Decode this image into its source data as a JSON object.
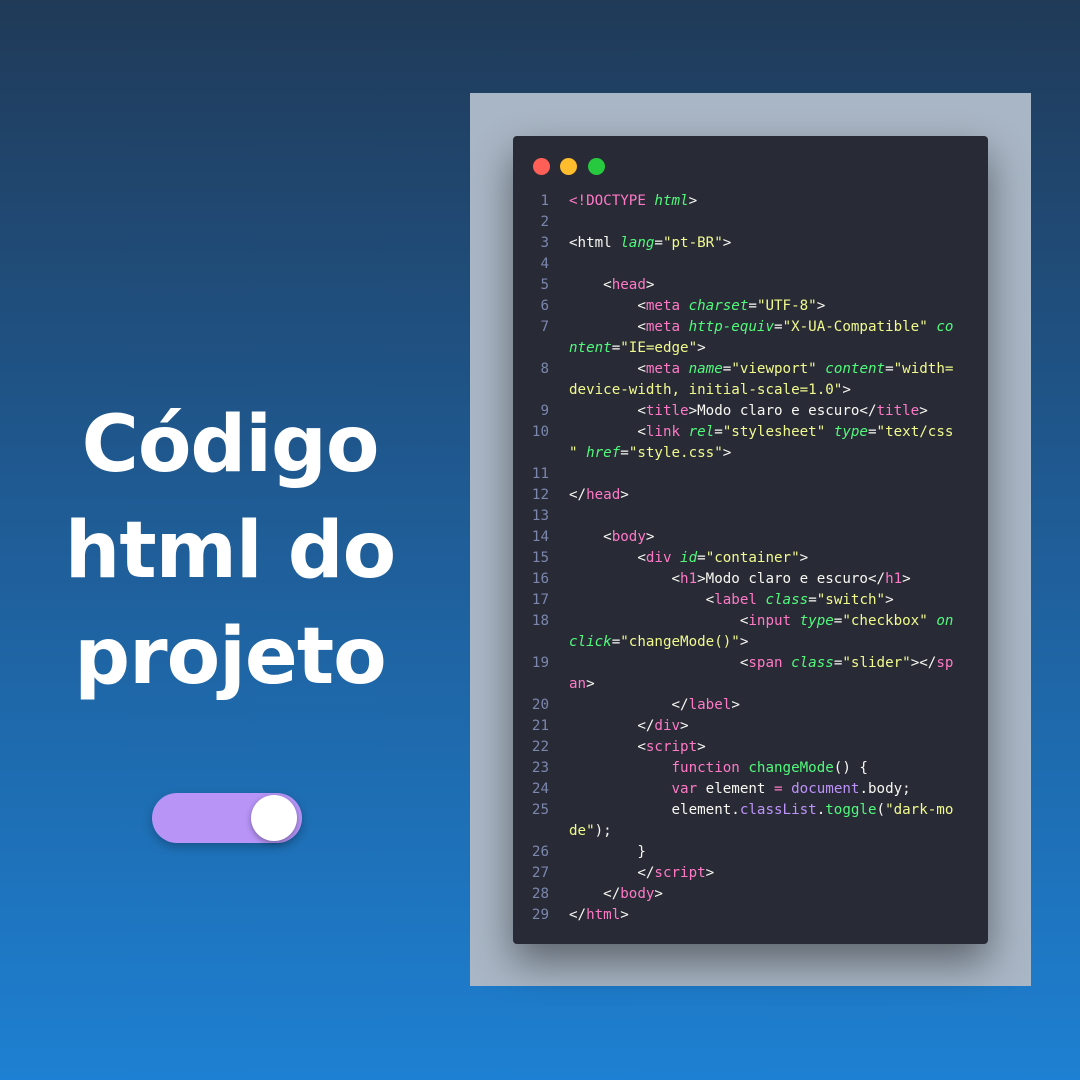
{
  "heading": {
    "line1": "Código",
    "line2": "html do",
    "line3": "projeto"
  },
  "toggle": {
    "state": "on",
    "track_color": "#b794f6",
    "knob_color": "#ffffff"
  },
  "editor": {
    "window_controls": [
      "close",
      "minimize",
      "maximize"
    ],
    "lines": [
      {
        "n": "1",
        "tokens": [
          {
            "t": "<!DOCTYPE ",
            "c": "tag"
          },
          {
            "t": "html",
            "c": "attr"
          },
          {
            "t": ">",
            "c": "text"
          }
        ]
      },
      {
        "n": "2",
        "tokens": []
      },
      {
        "n": "3",
        "tokens": [
          {
            "t": "<html ",
            "c": "text"
          },
          {
            "t": "lang",
            "c": "attr"
          },
          {
            "t": "=",
            "c": "text"
          },
          {
            "t": "\"pt-BR\"",
            "c": "str"
          },
          {
            "t": ">",
            "c": "text"
          }
        ]
      },
      {
        "n": "4",
        "tokens": []
      },
      {
        "n": "5",
        "tokens": [
          {
            "t": "    <",
            "c": "text"
          },
          {
            "t": "head",
            "c": "tag"
          },
          {
            "t": ">",
            "c": "text"
          }
        ]
      },
      {
        "n": "6",
        "tokens": [
          {
            "t": "        <",
            "c": "text"
          },
          {
            "t": "meta ",
            "c": "tag"
          },
          {
            "t": "charset",
            "c": "attr"
          },
          {
            "t": "=",
            "c": "text"
          },
          {
            "t": "\"UTF-8\"",
            "c": "str"
          },
          {
            "t": ">",
            "c": "text"
          }
        ]
      },
      {
        "n": "7",
        "tokens": [
          {
            "t": "        <",
            "c": "text"
          },
          {
            "t": "meta ",
            "c": "tag"
          },
          {
            "t": "http-equiv",
            "c": "attr"
          },
          {
            "t": "=",
            "c": "text"
          },
          {
            "t": "\"X-UA-Compatible\" ",
            "c": "str"
          },
          {
            "t": "co",
            "c": "attr"
          }
        ]
      },
      {
        "n": "",
        "tokens": [
          {
            "t": "ntent",
            "c": "attr"
          },
          {
            "t": "=",
            "c": "text"
          },
          {
            "t": "\"IE=edge\"",
            "c": "str"
          },
          {
            "t": ">",
            "c": "text"
          }
        ]
      },
      {
        "n": "8",
        "tokens": [
          {
            "t": "        <",
            "c": "text"
          },
          {
            "t": "meta ",
            "c": "tag"
          },
          {
            "t": "name",
            "c": "attr"
          },
          {
            "t": "=",
            "c": "text"
          },
          {
            "t": "\"viewport\" ",
            "c": "str"
          },
          {
            "t": "content",
            "c": "attr"
          },
          {
            "t": "=",
            "c": "text"
          },
          {
            "t": "\"width=",
            "c": "str"
          }
        ]
      },
      {
        "n": "",
        "tokens": [
          {
            "t": "device-width, initial-scale=1.0\"",
            "c": "str"
          },
          {
            "t": ">",
            "c": "text"
          }
        ]
      },
      {
        "n": "9",
        "tokens": [
          {
            "t": "        <",
            "c": "text"
          },
          {
            "t": "title",
            "c": "tag"
          },
          {
            "t": ">Modo claro e escuro</",
            "c": "text"
          },
          {
            "t": "title",
            "c": "tag"
          },
          {
            "t": ">",
            "c": "text"
          }
        ]
      },
      {
        "n": "10",
        "tokens": [
          {
            "t": "        <",
            "c": "text"
          },
          {
            "t": "link ",
            "c": "tag"
          },
          {
            "t": "rel",
            "c": "attr"
          },
          {
            "t": "=",
            "c": "text"
          },
          {
            "t": "\"stylesheet\" ",
            "c": "str"
          },
          {
            "t": "type",
            "c": "attr"
          },
          {
            "t": "=",
            "c": "text"
          },
          {
            "t": "\"text/css",
            "c": "str"
          }
        ]
      },
      {
        "n": "",
        "tokens": [
          {
            "t": "\" ",
            "c": "str"
          },
          {
            "t": "href",
            "c": "attr"
          },
          {
            "t": "=",
            "c": "text"
          },
          {
            "t": "\"style.css\"",
            "c": "str"
          },
          {
            "t": ">",
            "c": "text"
          }
        ]
      },
      {
        "n": "11",
        "tokens": []
      },
      {
        "n": "12",
        "tokens": [
          {
            "t": "</",
            "c": "text"
          },
          {
            "t": "head",
            "c": "tag"
          },
          {
            "t": ">",
            "c": "text"
          }
        ]
      },
      {
        "n": "13",
        "tokens": []
      },
      {
        "n": "14",
        "tokens": [
          {
            "t": "    <",
            "c": "text"
          },
          {
            "t": "body",
            "c": "tag"
          },
          {
            "t": ">",
            "c": "text"
          }
        ]
      },
      {
        "n": "15",
        "tokens": [
          {
            "t": "        <",
            "c": "text"
          },
          {
            "t": "div ",
            "c": "tag"
          },
          {
            "t": "id",
            "c": "attr"
          },
          {
            "t": "=",
            "c": "text"
          },
          {
            "t": "\"container\"",
            "c": "str"
          },
          {
            "t": ">",
            "c": "text"
          }
        ]
      },
      {
        "n": "16",
        "tokens": [
          {
            "t": "            <",
            "c": "text"
          },
          {
            "t": "h1",
            "c": "tag"
          },
          {
            "t": ">Modo claro e escuro</",
            "c": "text"
          },
          {
            "t": "h1",
            "c": "tag"
          },
          {
            "t": ">",
            "c": "text"
          }
        ]
      },
      {
        "n": "17",
        "tokens": [
          {
            "t": "                <",
            "c": "text"
          },
          {
            "t": "label ",
            "c": "tag"
          },
          {
            "t": "class",
            "c": "attr"
          },
          {
            "t": "=",
            "c": "text"
          },
          {
            "t": "\"switch\"",
            "c": "str"
          },
          {
            "t": ">",
            "c": "text"
          }
        ]
      },
      {
        "n": "18",
        "tokens": [
          {
            "t": "                    <",
            "c": "text"
          },
          {
            "t": "input ",
            "c": "tag"
          },
          {
            "t": "type",
            "c": "attr"
          },
          {
            "t": "=",
            "c": "text"
          },
          {
            "t": "\"checkbox\" ",
            "c": "str"
          },
          {
            "t": "on",
            "c": "attr"
          }
        ]
      },
      {
        "n": "",
        "tokens": [
          {
            "t": "click",
            "c": "attr"
          },
          {
            "t": "=",
            "c": "text"
          },
          {
            "t": "\"changeMode()\"",
            "c": "str"
          },
          {
            "t": ">",
            "c": "text"
          }
        ]
      },
      {
        "n": "19",
        "tokens": [
          {
            "t": "                    <",
            "c": "text"
          },
          {
            "t": "span ",
            "c": "tag"
          },
          {
            "t": "class",
            "c": "attr"
          },
          {
            "t": "=",
            "c": "text"
          },
          {
            "t": "\"slider\"",
            "c": "str"
          },
          {
            "t": "></",
            "c": "text"
          },
          {
            "t": "sp",
            "c": "tag"
          }
        ]
      },
      {
        "n": "",
        "tokens": [
          {
            "t": "an",
            "c": "tag"
          },
          {
            "t": ">",
            "c": "text"
          }
        ]
      },
      {
        "n": "20",
        "tokens": [
          {
            "t": "            </",
            "c": "text"
          },
          {
            "t": "label",
            "c": "tag"
          },
          {
            "t": ">",
            "c": "text"
          }
        ]
      },
      {
        "n": "21",
        "tokens": [
          {
            "t": "        </",
            "c": "text"
          },
          {
            "t": "div",
            "c": "tag"
          },
          {
            "t": ">",
            "c": "text"
          }
        ]
      },
      {
        "n": "22",
        "tokens": [
          {
            "t": "        <",
            "c": "text"
          },
          {
            "t": "script",
            "c": "tag"
          },
          {
            "t": ">",
            "c": "text"
          }
        ]
      },
      {
        "n": "23",
        "tokens": [
          {
            "t": "            ",
            "c": "text"
          },
          {
            "t": "function ",
            "c": "kw"
          },
          {
            "t": "changeMode",
            "c": "fn"
          },
          {
            "t": "() {",
            "c": "text"
          }
        ]
      },
      {
        "n": "24",
        "tokens": [
          {
            "t": "            ",
            "c": "text"
          },
          {
            "t": "var ",
            "c": "kw"
          },
          {
            "t": "element ",
            "c": "text"
          },
          {
            "t": "= ",
            "c": "kw"
          },
          {
            "t": "document",
            "c": "obj"
          },
          {
            "t": ".body;",
            "c": "text"
          }
        ]
      },
      {
        "n": "25",
        "tokens": [
          {
            "t": "            element.",
            "c": "text"
          },
          {
            "t": "classList",
            "c": "obj"
          },
          {
            "t": ".",
            "c": "text"
          },
          {
            "t": "toggle",
            "c": "fn"
          },
          {
            "t": "(",
            "c": "text"
          },
          {
            "t": "\"dark-mo",
            "c": "str"
          }
        ]
      },
      {
        "n": "",
        "tokens": [
          {
            "t": "de\"",
            "c": "str"
          },
          {
            "t": ");",
            "c": "text"
          }
        ]
      },
      {
        "n": "26",
        "tokens": [
          {
            "t": "        }",
            "c": "text"
          }
        ]
      },
      {
        "n": "27",
        "tokens": [
          {
            "t": "        </",
            "c": "text"
          },
          {
            "t": "script",
            "c": "tag"
          },
          {
            "t": ">",
            "c": "text"
          }
        ]
      },
      {
        "n": "28",
        "tokens": [
          {
            "t": "    </",
            "c": "text"
          },
          {
            "t": "body",
            "c": "tag"
          },
          {
            "t": ">",
            "c": "text"
          }
        ]
      },
      {
        "n": "29",
        "tokens": [
          {
            "t": "</",
            "c": "text"
          },
          {
            "t": "html",
            "c": "tag"
          },
          {
            "t": ">",
            "c": "text"
          }
        ]
      }
    ]
  }
}
